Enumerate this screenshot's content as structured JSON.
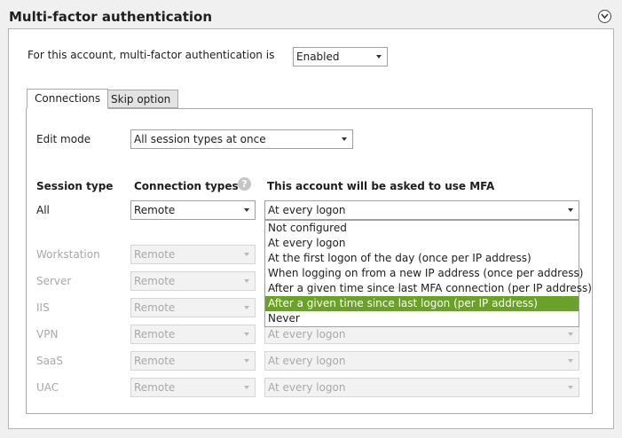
{
  "section": {
    "title": "Multi-factor authentication"
  },
  "account": {
    "label": "For this account, multi-factor authentication is",
    "status_value": "Enabled"
  },
  "tabs": [
    {
      "label": "Connections",
      "active": true
    },
    {
      "label": "Skip option",
      "active": false
    }
  ],
  "edit_mode": {
    "label": "Edit mode",
    "value": "All session types at once"
  },
  "table": {
    "headers": {
      "session_type": "Session type",
      "connection_types": "Connection types",
      "mfa": "This account will be asked to use MFA"
    },
    "rows": [
      {
        "session": "All",
        "connection": "Remote",
        "mfa": "At every logon",
        "enabled": true
      },
      {
        "session": "Workstation",
        "connection": "Remote",
        "mfa": "",
        "enabled": false
      },
      {
        "session": "Server",
        "connection": "Remote",
        "mfa": "",
        "enabled": false
      },
      {
        "session": "IIS",
        "connection": "Remote",
        "mfa": "",
        "enabled": false
      },
      {
        "session": "VPN",
        "connection": "Remote",
        "mfa": "At every logon",
        "enabled": false
      },
      {
        "session": "SaaS",
        "connection": "Remote",
        "mfa": "At every logon",
        "enabled": false
      },
      {
        "session": "UAC",
        "connection": "Remote",
        "mfa": "At every logon",
        "enabled": false
      }
    ]
  },
  "mfa_dropdown": {
    "options": [
      "Not configured",
      "At every logon",
      "At the first logon of the day (once per IP address)",
      "When logging on from a new IP address (once per address)",
      "After a given time since last MFA connection (per IP address)",
      "After a given time since last logon (per IP address)",
      "Never"
    ],
    "highlighted_index": 5,
    "highlight_color": "#69a12b"
  },
  "icons": {
    "collapse": "chevron-down-circle-icon",
    "help": "help-icon"
  },
  "help_glyph": "?"
}
